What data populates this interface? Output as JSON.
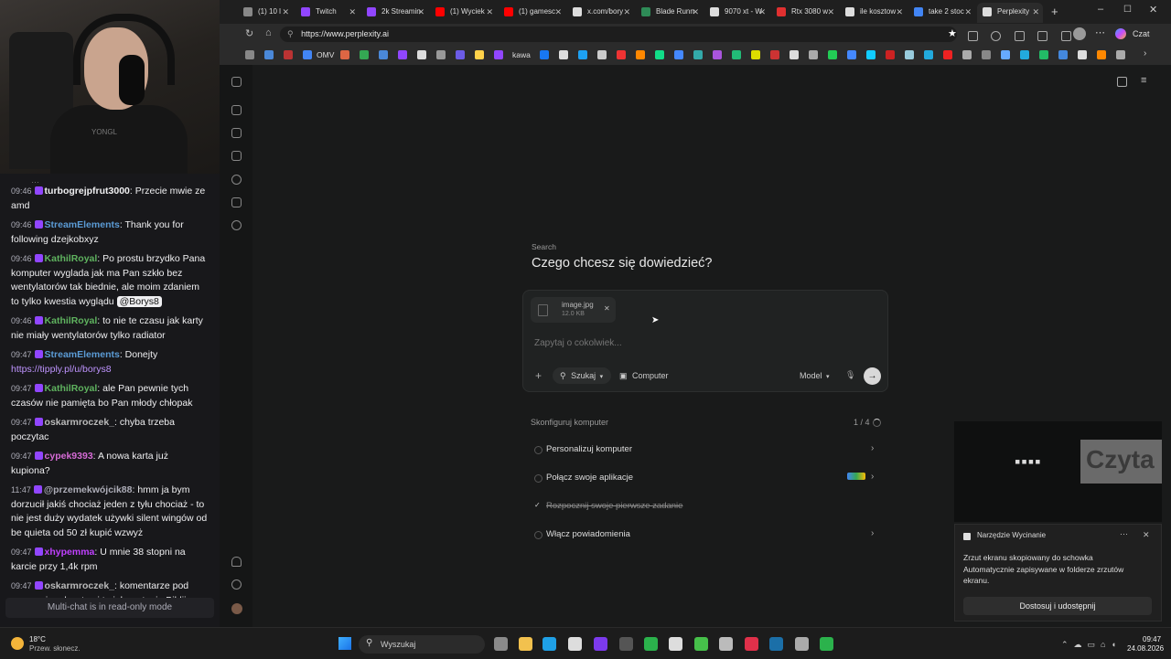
{
  "webcam": {
    "shirt_text": "YONGL"
  },
  "chat": {
    "messages": [
      {
        "time": "09:46",
        "user": "turbogrejpfrut3000",
        "user_color": "#efeff1",
        "text": "Przecie mwie ze amd"
      },
      {
        "time": "09:46",
        "user": "StreamElements",
        "user_color": "#5b9bd5",
        "text": "Thank you for following dzejkobxyz"
      },
      {
        "time": "09:46",
        "user": "KathilRoyal",
        "user_color": "#5fb35f",
        "text": "Po prostu brzydko Pana komputer wyglada jak ma Pan szkło bez wentylatorów tak biednie, ale moim zdaniem to tylko kwestia wyglądu",
        "mention": "@Borys8"
      },
      {
        "time": "09:46",
        "user": "KathilRoyal",
        "user_color": "#5fb35f",
        "text": "to nie te czasu jak karty nie miały wentylatorów tylko radiator"
      },
      {
        "time": "09:47",
        "user": "StreamElements",
        "user_color": "#5b9bd5",
        "text": "Donejty",
        "link": "https://tipply.pl/u/borys8"
      },
      {
        "time": "09:47",
        "user": "KathilRoyal",
        "user_color": "#5fb35f",
        "text": "ale Pan pewnie tych czasów nie pamięta bo Pan młody chłopak"
      },
      {
        "time": "09:47",
        "user": "oskarmroczek_",
        "user_color": "#bbbbbb",
        "text": "chyba trzeba poczytac"
      },
      {
        "time": "09:47",
        "user": "cypek9393",
        "user_color": "#d66bd6",
        "text": "A nowa karta już kupiona?"
      },
      {
        "time": "11:47",
        "user": "@przemekwójcik88",
        "user_color": "#adadb8",
        "text": "hmm ja bym dorzucił jakiś chociaż jeden z tyłu chociaż - to nie jest duży wydatek używki silent wingów od be quieta od 50 zł kupić wzwyż"
      },
      {
        "time": "09:47",
        "user": "xhypemma",
        "user_color": "#c040ff",
        "text": "U mnie 38 stopni na karcie przy 1,4k rpm"
      },
      {
        "time": "09:47",
        "user": "oskarmroczek_",
        "user_color": "#bbbbbb",
        "text": "komentarze pod waszymi podcastami to jak czytanie Biblii"
      }
    ],
    "footer": "Multi-chat is in read-only mode"
  },
  "browser": {
    "tabs": [
      {
        "label": "(1) 10 l",
        "color": "#888888"
      },
      {
        "label": "Twitch",
        "color": "#9146ff"
      },
      {
        "label": "2k Streamin",
        "color": "#9146ff"
      },
      {
        "label": "(1) Wyciek",
        "color": "#ff0000"
      },
      {
        "label": "(1) gamesc",
        "color": "#ff0000"
      },
      {
        "label": "x.com/bory",
        "color": "#dddddd"
      },
      {
        "label": "Blade Runn",
        "color": "#2e8b57"
      },
      {
        "label": "9070 xt - W",
        "color": "#dddddd"
      },
      {
        "label": "Rtx 3080 w",
        "color": "#e03030"
      },
      {
        "label": "ile kosztow",
        "color": "#dddddd"
      },
      {
        "label": "take 2 stoc",
        "color": "#4285f4"
      },
      {
        "label": "Perplexity",
        "color": "#dddddd"
      }
    ],
    "url": "https://www.perplexity.ai",
    "profile_label": "Czat",
    "bookmark_omv": "OMV",
    "bookmark_kawa": "kawa"
  },
  "perplexity": {
    "section_label": "Search",
    "heading": "Czego chcesz się dowiedzieć?",
    "attachment_name": "image.jpg",
    "attachment_size": "12.0 KB",
    "input_placeholder": "Zapytaj o cokolwiek...",
    "mode_search": "Szukaj",
    "mode_computer": "Computer",
    "model_label": "Model",
    "setup_title": "Skonfiguruj komputer",
    "setup_progress": "1 / 4",
    "setup_items": [
      {
        "label": "Personalizuj komputer",
        "done": false
      },
      {
        "label": "Połącz swoje aplikacje",
        "done": false
      },
      {
        "label": "Rozpocznij swoje pierwsze zadanie",
        "done": true
      },
      {
        "label": "Włącz powiadomienia",
        "done": false
      }
    ]
  },
  "snip": {
    "preview_text": "Czyta",
    "app_name": "Narzędzie Wycinanie",
    "line1": "Zrzut ekranu skopiowany do schowka",
    "line2": "Automatycznie zapisywane w folderze zrzutów ekranu.",
    "action": "Dostosuj i udostępnij"
  },
  "taskbar": {
    "weather_temp": "18°C",
    "weather_desc": "Przew. słonecz.",
    "search_placeholder": "Wyszukaj",
    "time": "09:47",
    "date": "24.08.2026"
  }
}
